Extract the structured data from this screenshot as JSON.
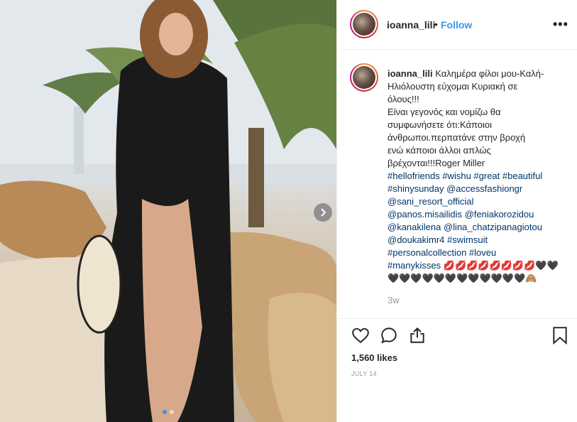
{
  "post": {
    "username": "ioanna_lili",
    "separator": "•",
    "follow_label": "Follow",
    "more_label": "•••",
    "caption_lines": [
      "Καλημέρα φίλοι μου-Καλή-",
      "Ηλιόλουστη εύχομαι Κυριακή σε",
      "όλους!!!",
      "Είναι γεγονός και νομίζω θα",
      "συμφωνήσετε ότι:Κάποιοι",
      "άνθρωποι.περπατάνε στην βροχή",
      "ενώ κάποιοι άλλοι απλώς",
      "βρέχονται!!!Roger Miller"
    ],
    "tag_lines": [
      "#hellofriends #wishu #great #beautiful",
      "#shinysunday @accessfashiongr",
      "@sani_resort_official",
      "@panos.misailidis @feniakorozidou",
      "@kanakilena @lina_chatzipanagiotou",
      "@doukakimr4 #swimsuit",
      "#personalcollection #loveu"
    ],
    "last_tag": "#manykisses",
    "emoji_line_1": "💋💋💋💋💋💋💋💋🖤🖤",
    "emoji_line_2": "🖤🖤🖤🖤🖤🖤🖤🖤🖤🖤🖤🖤🙈",
    "time_ago": "3w",
    "likes": "1,560 likes",
    "date": "JULY 14",
    "carousel": {
      "count": 2,
      "active_index": 0
    }
  },
  "icons": {
    "like": "heart-icon",
    "comment": "comment-icon",
    "share": "share-icon",
    "save": "bookmark-icon",
    "next": "chevron-right-icon"
  },
  "colors": {
    "link": "#3897f0",
    "tag": "#003569",
    "muted": "#999999",
    "text": "#262626"
  }
}
